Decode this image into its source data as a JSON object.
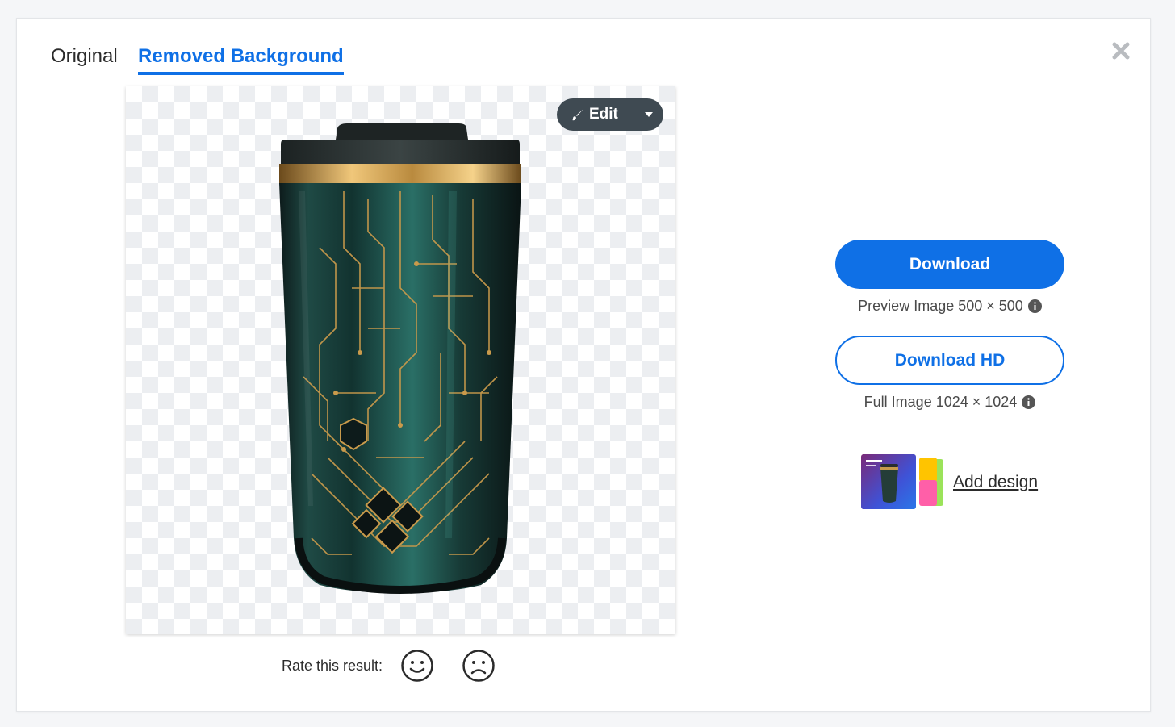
{
  "tabs": {
    "original": "Original",
    "removed": "Removed Background"
  },
  "editor": {
    "edit_label": "Edit"
  },
  "rating": {
    "label": "Rate this result:"
  },
  "download": {
    "label": "Download",
    "caption": "Preview Image 500 × 500"
  },
  "download_hd": {
    "label": "Download HD",
    "caption": "Full Image 1024 × 1024"
  },
  "add_design": {
    "label": "Add design"
  },
  "colors": {
    "accent": "#0f70e6",
    "edit_button": "#3f4a52",
    "checker": "#eceef1"
  },
  "icons": [
    "close-icon",
    "brush-icon",
    "chevron-down-icon",
    "smile-icon",
    "frown-icon",
    "info-icon"
  ]
}
